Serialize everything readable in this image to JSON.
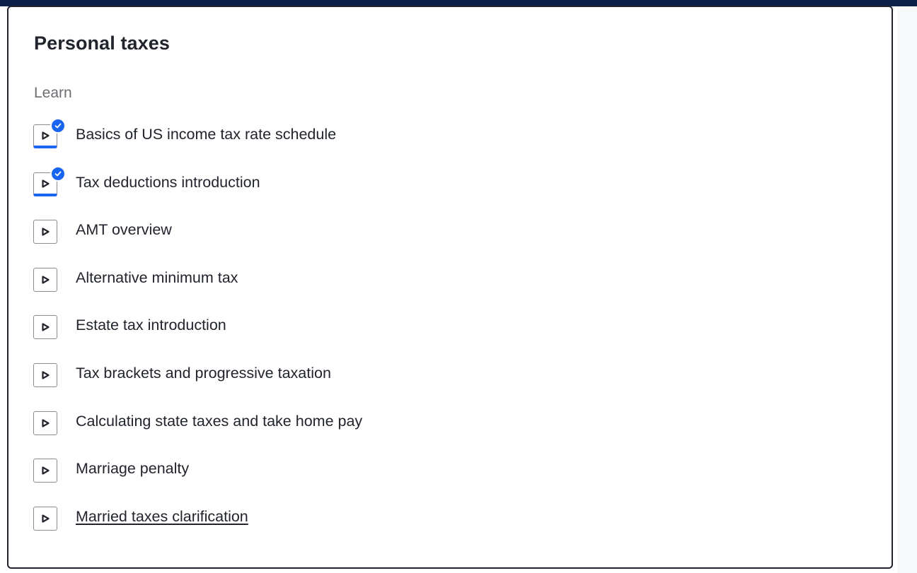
{
  "card": {
    "title": "Personal taxes",
    "section_label": "Learn"
  },
  "items": [
    {
      "label": "Basics of US income tax rate schedule",
      "completed": true
    },
    {
      "label": "Tax deductions introduction",
      "completed": true
    },
    {
      "label": "AMT overview",
      "completed": false
    },
    {
      "label": "Alternative minimum tax",
      "completed": false
    },
    {
      "label": "Estate tax introduction",
      "completed": false
    },
    {
      "label": "Tax brackets and progressive taxation",
      "completed": false
    },
    {
      "label": "Calculating state taxes and take home pay",
      "completed": false
    },
    {
      "label": "Marriage penalty",
      "completed": false
    },
    {
      "label": "Married taxes clarification",
      "completed": false,
      "hovered": true
    }
  ],
  "icons": {
    "item_icon": "video-play-icon",
    "completed_icon": "checkmark-badge-icon"
  },
  "colors": {
    "accent": "#1865f2",
    "top_bar": "#0b1f4a",
    "text": "#21242c",
    "muted": "#6b6d73"
  }
}
